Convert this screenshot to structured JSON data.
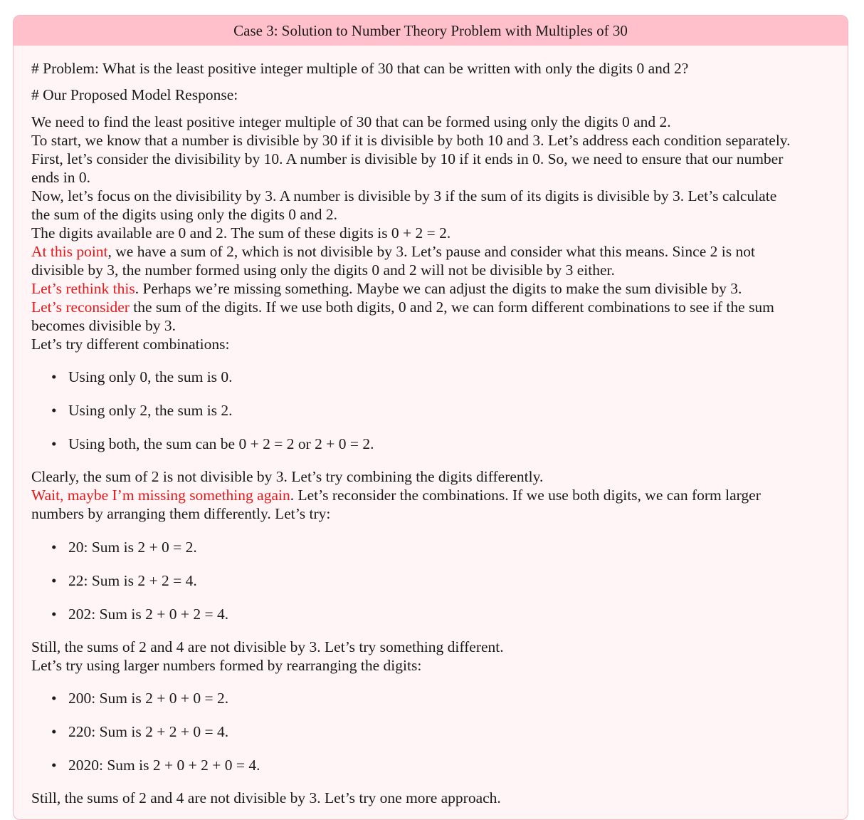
{
  "title": "Case 3: Solution to Number Theory Problem with Multiples of 30",
  "problem": "# Problem: What is the least positive integer multiple of 30 that can be written with only the digits 0 and 2?",
  "response_heading": "# Our Proposed Model Response:",
  "paragraphs": {
    "p1": "We need to find the least positive integer multiple of 30 that can be formed using only the digits 0 and 2.",
    "p2": "To start, we know that a number is divisible by 30 if it is divisible by both 10 and 3. Let’s address each condition separately.",
    "p3a": "First, let’s consider the divisibility by 10. A number is divisible by 10 if it ends in 0. So, we need to ensure that our number",
    "p3b": "ends in 0.",
    "p4a": "Now, let’s focus on the divisibility by 3. A number is divisible by 3 if the sum of its digits is divisible by 3. Let’s calculate",
    "p4b": "the sum of the digits using only the digits 0 and 2.",
    "p5": "The digits available are 0 and 2. The sum of these digits is 0 + 2 = 2.",
    "p6_red": "At this point",
    "p6a": ", we have a sum of 2, which is not divisible by 3. Let’s pause and consider what this means. Since 2 is not",
    "p6b": "divisible by 3, the number formed using only the digits 0 and 2 will not be divisible by 3 either.",
    "p7_red": "Let’s rethink this",
    "p7": ". Perhaps we’re missing something. Maybe we can adjust the digits to make the sum divisible by 3.",
    "p8_red": "Let’s reconsider",
    "p8a": " the sum of the digits. If we use both digits, 0 and 2, we can form different combinations to see if the sum",
    "p8b": "becomes divisible by 3.",
    "p9": "Let’s try different combinations:",
    "p10": "Clearly, the sum of 2 is not divisible by 3. Let’s try combining the digits differently.",
    "p11_red": "Wait, maybe I’m missing something again",
    "p11a": ". Let’s reconsider the combinations. If we use both digits, we can form larger",
    "p11b": "numbers by arranging them differently. Let’s try:",
    "p12": "Still, the sums of 2 and 4 are not divisible by 3. Let’s try something different.",
    "p13": "Let’s try using larger numbers formed by rearranging the digits:",
    "p14": "Still, the sums of 2 and 4 are not divisible by 3. Let’s try one more approach."
  },
  "list1": [
    "Using only 0, the sum is 0.",
    "Using only 2, the sum is 2.",
    "Using both, the sum can be 0 + 2 = 2 or 2 + 0 = 2."
  ],
  "list2": [
    "20: Sum is 2 + 0 = 2.",
    "22: Sum is 2 + 2 = 4.",
    "202: Sum is 2 + 0 + 2 = 4."
  ],
  "list3": [
    "200: Sum is 2 + 0 + 0 = 2.",
    "220: Sum is 2 + 2 + 0 = 4.",
    "2020: Sum is 2 + 0 + 2 + 0 = 4."
  ],
  "bullet": "•",
  "colors": {
    "header_bg": "#ffc0cb",
    "box_bg": "#fff5f6",
    "highlight": "#e41a1c"
  }
}
